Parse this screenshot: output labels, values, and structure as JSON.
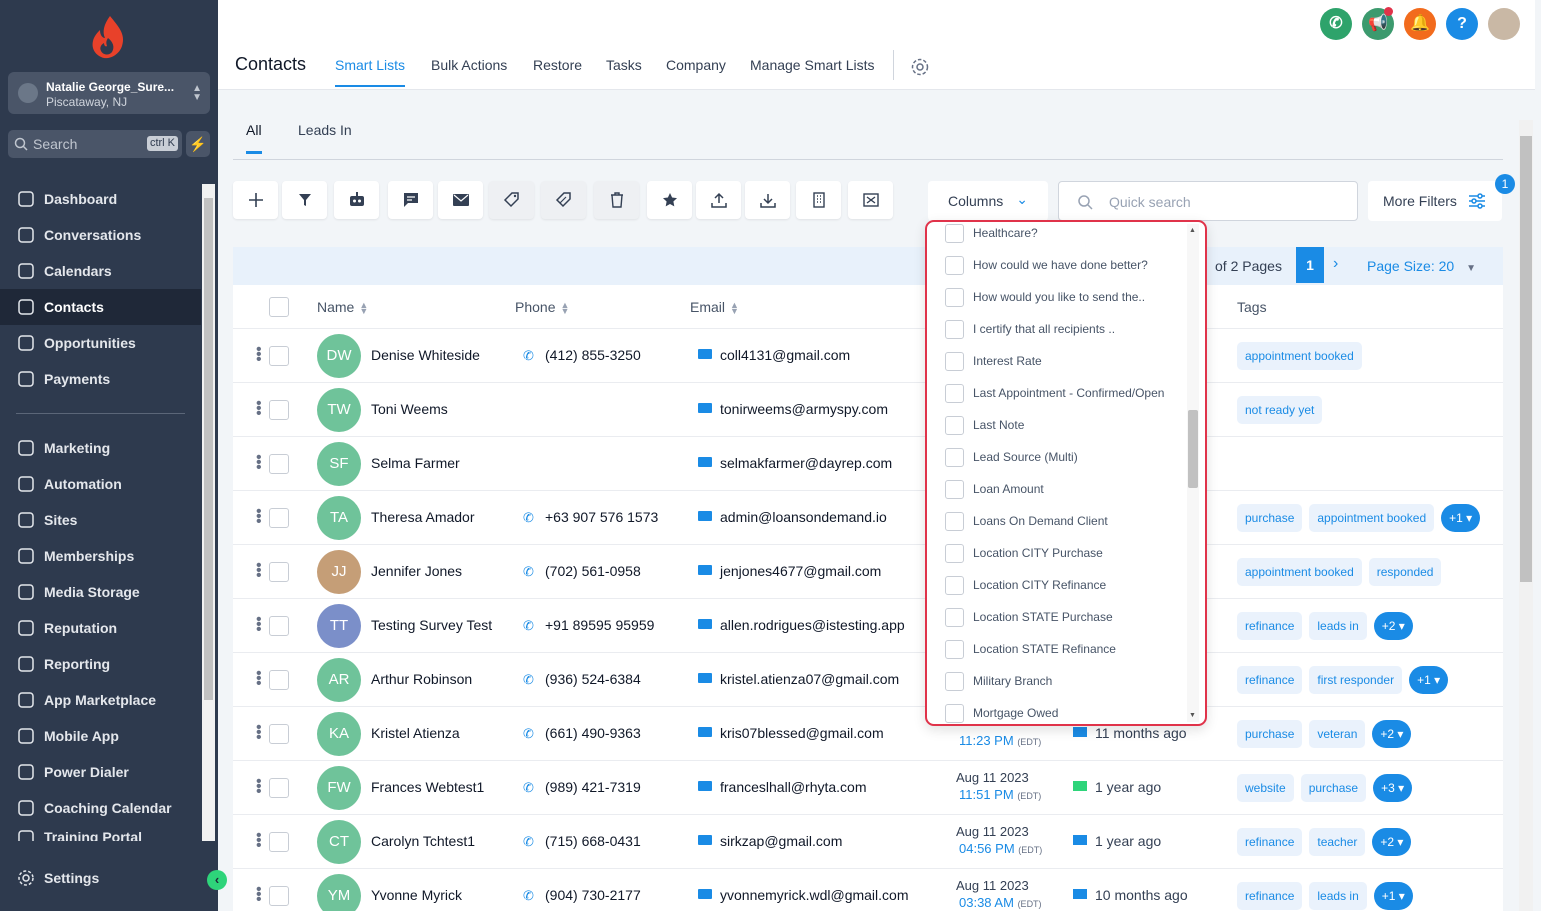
{
  "sidebar": {
    "account_name": "Natalie George_Sure...",
    "account_location": "Piscataway, NJ",
    "search_placeholder": "Search",
    "search_shortcut": "ctrl K",
    "nav": [
      {
        "label": "Dashboard",
        "icon": "dashboard-icon"
      },
      {
        "label": "Conversations",
        "icon": "chat-icon"
      },
      {
        "label": "Calendars",
        "icon": "calendar-icon"
      },
      {
        "label": "Contacts",
        "icon": "contacts-icon",
        "active": true
      },
      {
        "label": "Opportunities",
        "icon": "opportunities-icon"
      },
      {
        "label": "Payments",
        "icon": "payments-icon"
      },
      {
        "label": "Marketing",
        "icon": "send-icon"
      },
      {
        "label": "Automation",
        "icon": "automation-icon"
      },
      {
        "label": "Sites",
        "icon": "sites-icon"
      },
      {
        "label": "Memberships",
        "icon": "memberships-icon"
      },
      {
        "label": "Media Storage",
        "icon": "image-icon"
      },
      {
        "label": "Reputation",
        "icon": "star-icon"
      },
      {
        "label": "Reporting",
        "icon": "trend-icon"
      },
      {
        "label": "App Marketplace",
        "icon": "apps-icon"
      },
      {
        "label": "Mobile App",
        "icon": "mobile-icon"
      },
      {
        "label": "Power Dialer",
        "icon": "phone-icon"
      },
      {
        "label": "Coaching Calendar",
        "icon": "calendar-grid-icon"
      },
      {
        "label": "Training Portal",
        "icon": "training-icon"
      }
    ],
    "settings_label": "Settings"
  },
  "header": {
    "title": "Contacts",
    "tabs": [
      "Smart Lists",
      "Bulk Actions",
      "Restore",
      "Tasks",
      "Company",
      "Manage Smart Lists"
    ],
    "active_tab": "Smart Lists"
  },
  "subtabs": {
    "items": [
      "All",
      "Leads In"
    ],
    "active": "All"
  },
  "toolbar": {
    "columns_label": "Columns",
    "quick_search_placeholder": "Quick search",
    "more_filters_label": "More Filters",
    "filter_count": "1"
  },
  "pager": {
    "pages_text": "of 2 Pages",
    "current_page": "1",
    "page_size_text": "Page Size: 20"
  },
  "table": {
    "headers": {
      "name": "Name",
      "phone": "Phone",
      "email": "Email",
      "tags": "Tags"
    },
    "rows": [
      {
        "initials": "DW",
        "color": "#6fc39a",
        "name": "Denise Whiteside",
        "phone": "(412) 855-3250",
        "email": "coll4131@gmail.com",
        "date": "",
        "time": "",
        "tz": "",
        "activity": "",
        "tags": [
          "appointment booked"
        ],
        "more": ""
      },
      {
        "initials": "TW",
        "color": "#6fc39a",
        "name": "Toni Weems",
        "phone": "",
        "email": "tonirweems@armyspy.com",
        "date": "",
        "time": "",
        "tz": "",
        "activity": "",
        "tags": [
          "not ready yet"
        ],
        "more": ""
      },
      {
        "initials": "SF",
        "color": "#6fc39a",
        "name": "Selma Farmer",
        "phone": "",
        "email": "selmakfarmer@dayrep.com",
        "date": "",
        "time": "",
        "tz": "",
        "activity": "",
        "tags": [],
        "more": ""
      },
      {
        "initials": "TA",
        "color": "#6fc39a",
        "name": "Theresa Amador",
        "phone": "+63 907 576 1573",
        "email": "admin@loansondemand.io",
        "date": "",
        "time": "",
        "tz": "",
        "activity": "",
        "tags": [
          "purchase",
          "appointment booked"
        ],
        "more": "+1"
      },
      {
        "initials": "JJ",
        "color": "#c59e77",
        "name": "Jennifer Jones",
        "phone": "(702) 561-0958",
        "email": "jenjones4677@gmail.com",
        "date": "",
        "time": "",
        "tz": "",
        "activity": "",
        "tags": [
          "appointment booked",
          "responded"
        ],
        "more": ""
      },
      {
        "initials": "TT",
        "color": "#7b8fc9",
        "name": "Testing Survey Test",
        "phone": "+91 89595 95959",
        "email": "allen.rodrigues@istesting.app",
        "date": "",
        "time": "",
        "tz": "",
        "activity": "",
        "tags": [
          "refinance",
          "leads in"
        ],
        "more": "+2"
      },
      {
        "initials": "AR",
        "color": "#6fc39a",
        "name": "Arthur Robinson",
        "phone": "(936) 524-6384",
        "email": "kristel.atienza07@gmail.com",
        "date": "",
        "time": "",
        "tz": "",
        "activity": "",
        "tags": [
          "refinance",
          "first responder"
        ],
        "more": "+1"
      },
      {
        "initials": "KA",
        "color": "#6fc39a",
        "name": "Kristel Atienza",
        "phone": "(661) 490-9363",
        "email": "kris07blessed@gmail.com",
        "date": "",
        "time": "11:23 PM",
        "tz": "(EDT)",
        "activity": "11 months ago",
        "activity_icon": "mail",
        "tags": [
          "purchase",
          "veteran"
        ],
        "more": "+2"
      },
      {
        "initials": "FW",
        "color": "#6fc39a",
        "name": "Frances Webtest1",
        "phone": "(989) 421-7319",
        "email": "franceslhall@rhyta.com",
        "date": "Aug 11 2023",
        "time": "11:51 PM",
        "tz": "(EDT)",
        "activity": "1 year ago",
        "activity_icon": "chat",
        "tags": [
          "website",
          "purchase"
        ],
        "more": "+3"
      },
      {
        "initials": "CT",
        "color": "#6fc39a",
        "name": "Carolyn Tchtest1",
        "phone": "(715) 668-0431",
        "email": "sirkzap@gmail.com",
        "date": "Aug 11 2023",
        "time": "04:56 PM",
        "tz": "(EDT)",
        "activity": "1 year ago",
        "activity_icon": "mail",
        "tags": [
          "refinance",
          "teacher"
        ],
        "more": "+2"
      },
      {
        "initials": "YM",
        "color": "#6fc39a",
        "name": "Yvonne Myrick",
        "phone": "(904) 730-2177",
        "email": "yvonnemyrick.wdl@gmail.com",
        "date": "Aug 11 2023",
        "time": "03:38 AM",
        "tz": "(EDT)",
        "activity": "10 months ago",
        "activity_icon": "mail",
        "tags": [
          "refinance",
          "leads in"
        ],
        "more": "+1"
      }
    ]
  },
  "columns_dropdown": {
    "items": [
      "Healthcare?",
      "How could we have done better?",
      "How would you like to send the..",
      "I certify that all recipients ..",
      "Interest Rate",
      "Last Appointment - Confirmed/Open",
      "Last Note",
      "Lead Source (Multi)",
      "Loan Amount",
      "Loans On Demand Client",
      "Location CITY Purchase",
      "Location CITY Refinance",
      "Location STATE Purchase",
      "Location STATE Refinance",
      "Military Branch",
      "Mortgage Owed"
    ]
  },
  "colors": {
    "accent": "#1a8be5",
    "sidebar": "#2e3a4e",
    "highlight_border": "#e0334a",
    "green": "#2ed47a"
  }
}
